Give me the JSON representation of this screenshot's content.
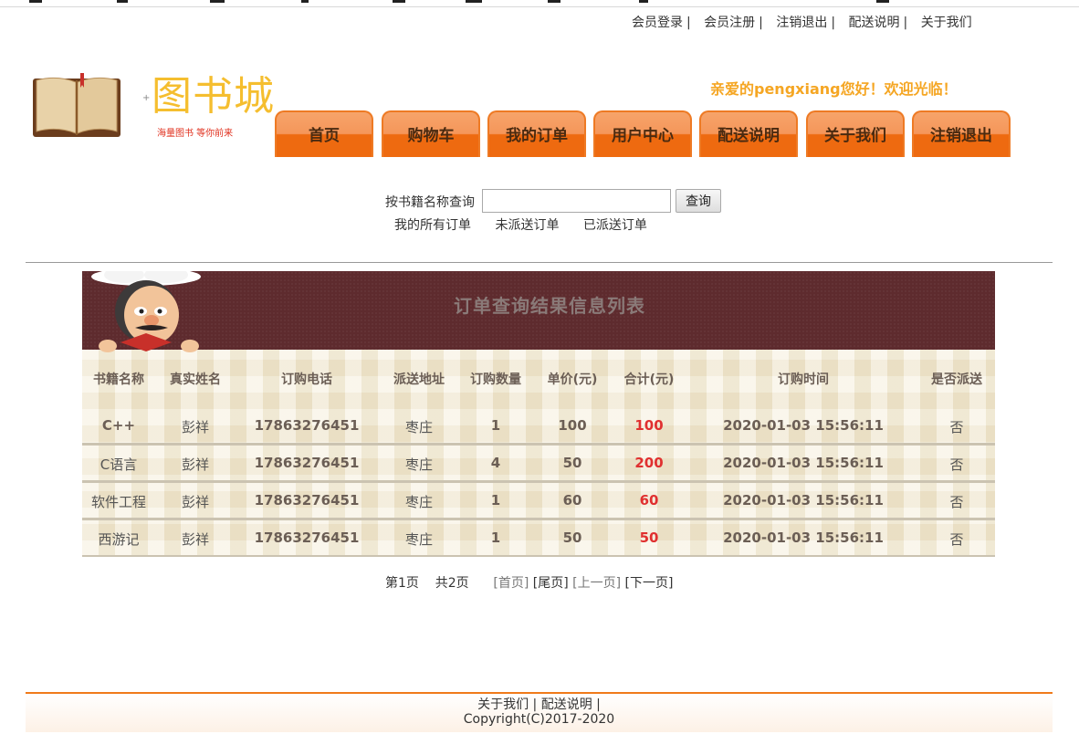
{
  "top_links": [
    {
      "label": "会员登录",
      "sep": "|"
    },
    {
      "label": "会员注册",
      "sep": "|"
    },
    {
      "label": "注销退出",
      "sep": "|"
    },
    {
      "label": "配送说明",
      "sep": "|"
    },
    {
      "label": "关于我们",
      "sep": ""
    }
  ],
  "logo": {
    "title": "图书城",
    "tagline": "海量图书 等你前来",
    "dot": "+"
  },
  "welcome": "亲爱的pengxiang您好！欢迎光临！",
  "nav": [
    "首页",
    "购物车",
    "我的订单",
    "用户中心",
    "配送说明",
    "关于我们",
    "注销退出"
  ],
  "search": {
    "label": "按书籍名称查询",
    "value": "",
    "button": "查询"
  },
  "filters": [
    "我的所有订单",
    "未派送订单",
    "已派送订单"
  ],
  "table": {
    "title": "订单查询结果信息列表",
    "headers": [
      "书籍名称",
      "真实姓名",
      "订购电话",
      "派送地址",
      "订购数量",
      "单价(元)",
      "合计(元)",
      "订购时间",
      "是否派送"
    ],
    "rows": [
      [
        "C++",
        "彭祥",
        "17863276451",
        "枣庄",
        "1",
        "100",
        "100",
        "2020-01-03 15:56:11",
        "否"
      ],
      [
        "C语言",
        "彭祥",
        "17863276451",
        "枣庄",
        "4",
        "50",
        "200",
        "2020-01-03 15:56:11",
        "否"
      ],
      [
        "软件工程",
        "彭祥",
        "17863276451",
        "枣庄",
        "1",
        "60",
        "60",
        "2020-01-03 15:56:11",
        "否"
      ],
      [
        "西游记",
        "彭祥",
        "17863276451",
        "枣庄",
        "1",
        "50",
        "50",
        "2020-01-03 15:56:11",
        "否"
      ]
    ]
  },
  "pager": {
    "current": "第1页",
    "total": "共2页",
    "first": "[首页]",
    "last": "[尾页]",
    "prev": "[上一页]",
    "next": "[下一页]"
  },
  "footer": {
    "links": "关于我们 |   配送说明 |",
    "copyright": "Copyright(C)2017-2020"
  },
  "colors": {
    "accent": "#ee6a10",
    "welcome": "#f5a623",
    "total_red": "#e03030",
    "panel_head": "#5e2b2e"
  }
}
